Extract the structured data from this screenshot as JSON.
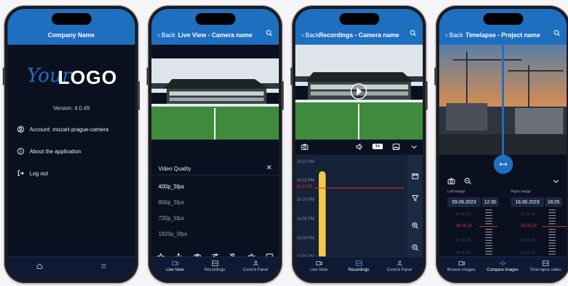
{
  "colors": {
    "brand_blue": "#1f6fc1",
    "dark_bg": "#0b1020",
    "accent_yellow": "#f4c64a",
    "time_red": "#e0332f"
  },
  "phone1": {
    "header_title": "Company Name",
    "logo_script": "Your",
    "logo_bold": "LOGO",
    "version": "Version: 4.0.49",
    "menu": [
      {
        "icon": "account-icon",
        "label": "Account: mozart-prague-camera"
      },
      {
        "icon": "info-icon",
        "label": "About the application"
      },
      {
        "icon": "logout-icon",
        "label": "Log out"
      }
    ],
    "tabs": [
      {
        "icon": "home-icon"
      },
      {
        "icon": "hamburger-menu-icon"
      }
    ]
  },
  "phone2": {
    "back_label": "Back",
    "title": "Live View - Camera name",
    "video_quality_label": "Video Quality",
    "quality_options": [
      "400p_5fps",
      "800p_5fps",
      "720p_5fps",
      "1920p_5fps"
    ],
    "selected_quality": "400p_5fps",
    "tools": [
      "star-icon",
      "move-icon",
      "camera-icon",
      "settings-icon",
      "mic-off-icon",
      "speaker-off-icon",
      "image-icon"
    ],
    "tabs": [
      "Live View",
      "Recordings",
      "Control Panel"
    ],
    "active_tab": "Live View"
  },
  "phone3": {
    "back_label": "Back",
    "title": "Recordings - Camera name",
    "speed": "1x",
    "times": [
      "16:20 PM",
      "16:15 PM",
      "16:10 PM",
      "16:05 PM",
      "16:00 PM",
      "15:55 PM"
    ],
    "current_time": "16:13:55",
    "tabs": [
      "Live View",
      "Recordings",
      "Control Panel"
    ],
    "active_tab": "Recordings"
  },
  "phone4": {
    "back_label": "Back",
    "title": "Timelapse - Project name",
    "left_label": "Left image",
    "right_label": "Right image",
    "left_date": "09.06.2023",
    "left_time": "12:30",
    "right_date": "16.06.2023",
    "right_time": "18:25",
    "left_list": [
      "10.06.23",
      "09.06.23",
      "07.06.23",
      "06.06.23"
    ],
    "right_list": [
      "17.06.23",
      "16.06.23",
      "14.06.23",
      "13.06.23"
    ],
    "tabs": [
      "Browse images",
      "Compare images",
      "Time-lapse video"
    ],
    "active_tab": "Compare images"
  }
}
